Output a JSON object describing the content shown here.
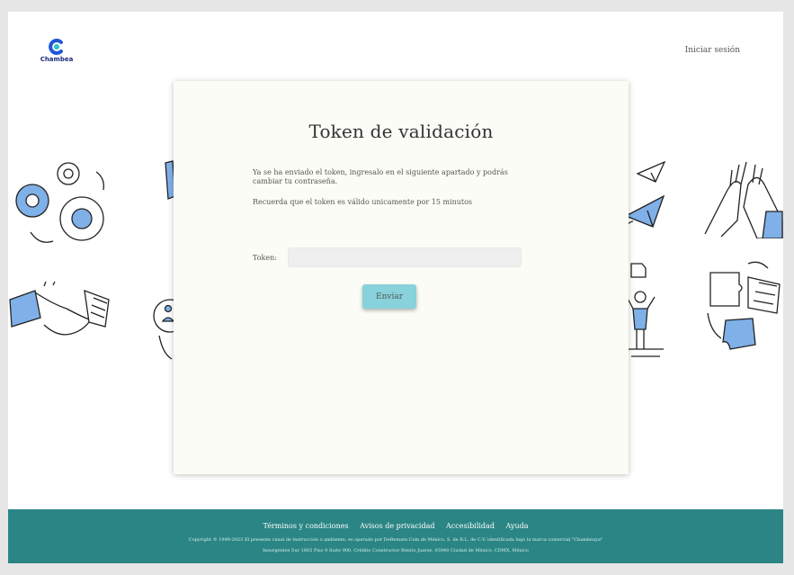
{
  "header": {
    "logo_text": "Chambea",
    "login_label": "Iniciar sesión"
  },
  "card": {
    "title": "Token de validación",
    "message_1": "Ya se ha enviado el token, ingresalo en el siguiente apartado y podrás cambiar tu contraseña.",
    "message_2": "Recuerda que el token es válido unicamente por 15 minutos",
    "token_label": "Token:",
    "token_value": "",
    "submit_label": "Enviar"
  },
  "footer": {
    "links": [
      "Términos y condiciones",
      "Avisos de privacidad",
      "Accesibilidad",
      "Ayuda"
    ],
    "copyright_1": "Copyright © 1999-2023 El presente canal de instrucción o ambiente, es operado por DeRemate.Com de México, S. de R.L. de C.V. identificada bajo la marca comercial \"Chambeaya\"",
    "copyright_2": "Insurgentes Sur 1602 Piso 9 Suite 900, Crédito Constructor Benito Juarez, 03940 Ciudad de México, CDMX, México"
  },
  "colors": {
    "footer_bg": "#2b8585",
    "button_bg": "#87d2db",
    "logo_blue": "#1f56d8",
    "logo_teal": "#2fc2c6",
    "illustration_blue": "#7fb0e8"
  },
  "illustrations": [
    "gears-icon",
    "handshake-icon",
    "person-target-icon",
    "paper-planes-icon",
    "person-celebrating-icon",
    "high-five-icon",
    "puzzle-icon"
  ]
}
